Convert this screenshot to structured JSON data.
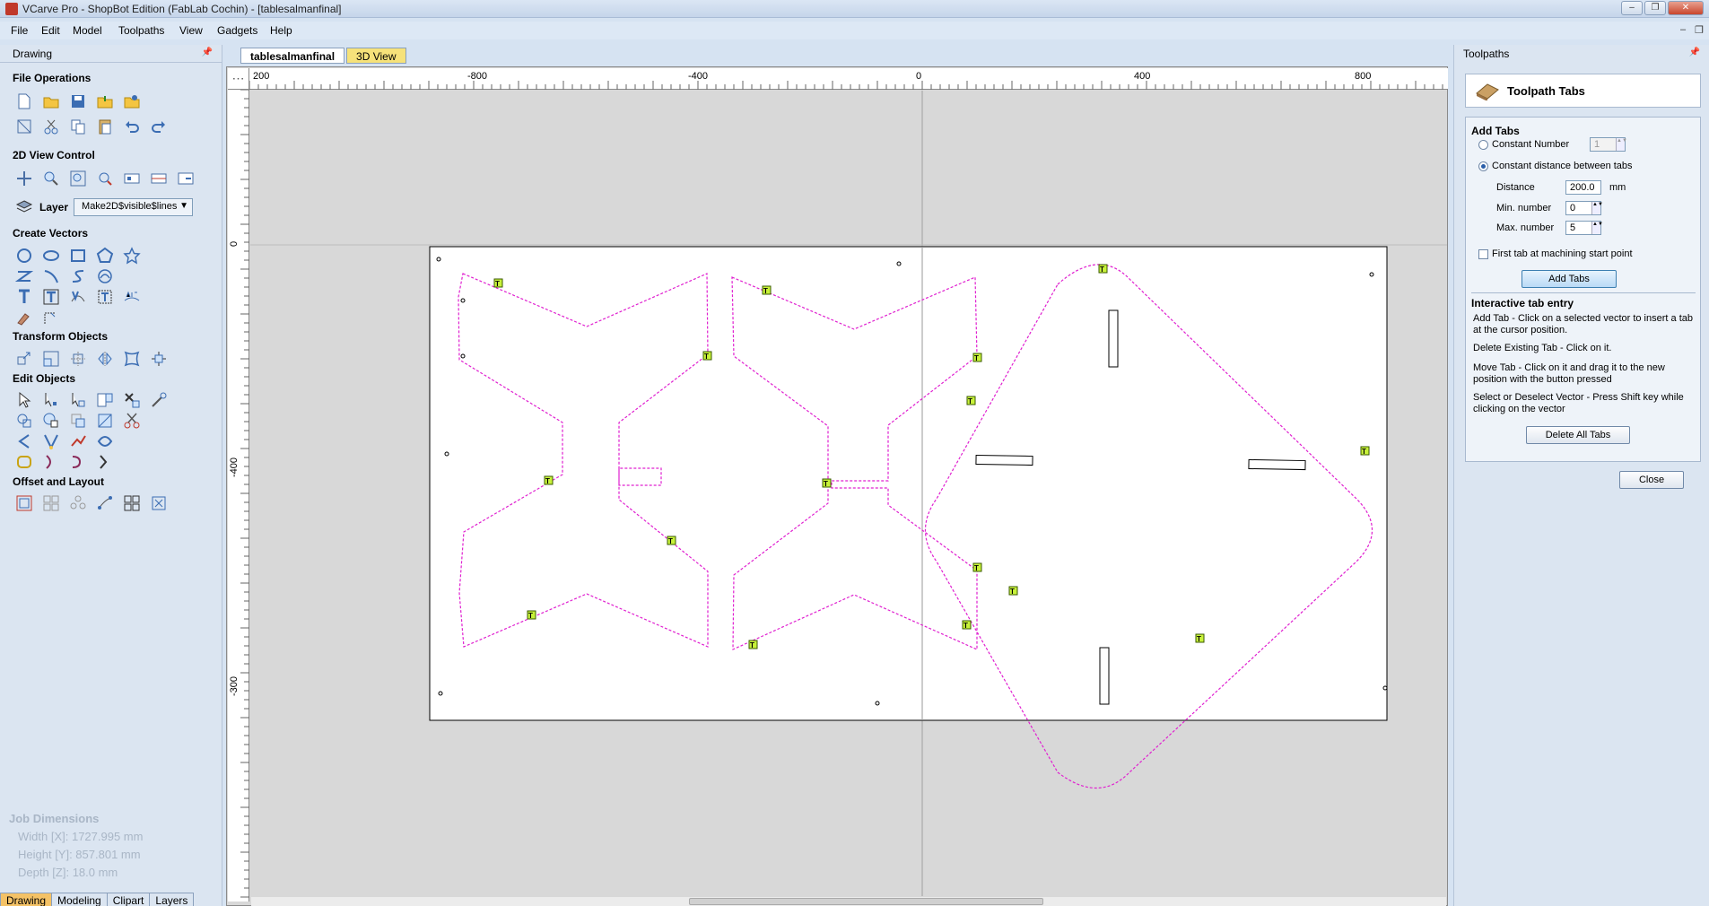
{
  "window": {
    "title": "VCarve Pro - ShopBot Edition (FabLab Cochin) - [tablesalmanfinal]",
    "controls": {
      "minimize": "–",
      "restore": "❐",
      "close": "✕"
    }
  },
  "menu": [
    "File",
    "Edit",
    "Model",
    "Toolpaths",
    "View",
    "Gadgets",
    "Help"
  ],
  "mdi_controls": {
    "minimize": "–",
    "restore": "❐"
  },
  "left_panel": {
    "title": "Drawing",
    "pin": "📌",
    "sections": {
      "file_operations": "File Operations",
      "view_control": "2D View Control",
      "create_vectors": "Create Vectors",
      "transform_objects": "Transform Objects",
      "edit_objects": "Edit Objects",
      "offset_layout": "Offset and Layout"
    },
    "layer_label": "Layer",
    "layer_value": "Make2D$visible$lines",
    "layer_arrow": "▼"
  },
  "job_dimensions": {
    "title": "Job Dimensions",
    "width": "Width  [X]: 1727.995 mm",
    "height": "Height [Y]: 857.801 mm",
    "depth": "Depth  [Z]: 18.0 mm"
  },
  "bottom_tabs": [
    "Drawing",
    "Modeling",
    "Clipart",
    "Layers"
  ],
  "doc_tabs": [
    "tablesalmanfinal",
    "3D View"
  ],
  "ruler": {
    "corner": "⋯",
    "h_labels": [
      "200",
      "-800",
      "-400",
      "0",
      "400",
      "800"
    ],
    "v_labels": [
      "0",
      "-400",
      "-300"
    ]
  },
  "right_panel": {
    "title": "Toolpaths",
    "pin": "📌",
    "tool_title": "Toolpath Tabs",
    "add_tabs_heading": "Add Tabs",
    "constant_number_label": "Constant Number",
    "constant_number_value": "1",
    "constant_distance_label": "Constant distance between tabs",
    "distance_label": "Distance",
    "distance_value": "200.0",
    "distance_unit": "mm",
    "min_label": "Min. number",
    "min_value": "0",
    "max_label": "Max. number",
    "max_value": "5",
    "first_tab_label": "First tab at machining start point",
    "add_tabs_button": "Add Tabs",
    "interactive_heading": "Interactive tab entry",
    "help_add": "Add Tab - Click on a selected vector to insert a tab at the cursor position.",
    "help_delete": "Delete Existing Tab - Click on it.",
    "help_move": "Move Tab - Click on it and drag it to the new position with the button pressed",
    "help_select": "Select or Deselect Vector - Press Shift key while clicking on the vector",
    "delete_all_button": "Delete All Tabs",
    "close_button": "Close",
    "spin_arrows": "▲▼"
  },
  "canvas": {
    "tab_marker_letter": "T"
  }
}
